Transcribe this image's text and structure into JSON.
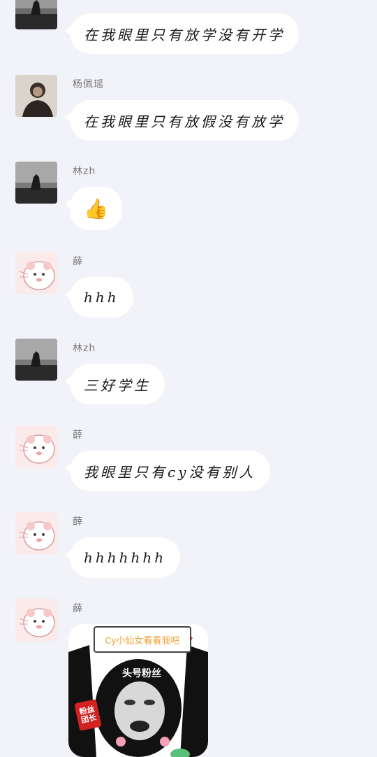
{
  "messages": [
    {
      "sender": "",
      "avatar": "dark-silhouette-avatar",
      "text": "在我眼里只有放学没有开学"
    },
    {
      "sender": "杨佩瑶",
      "avatar": "portrait-avatar",
      "text": "在我眼里只有放假没有放学"
    },
    {
      "sender": "林zh",
      "avatar": "dark-silhouette-avatar",
      "text": "👍"
    },
    {
      "sender": "薛",
      "avatar": "hamster-avatar",
      "text": "hhh"
    },
    {
      "sender": "林zh",
      "avatar": "dark-silhouette-avatar",
      "text": "三好学生"
    },
    {
      "sender": "薛",
      "avatar": "hamster-avatar",
      "text": "我眼里只有cy没有别人"
    },
    {
      "sender": "薛",
      "avatar": "hamster-avatar",
      "text": "hhhhhhh"
    },
    {
      "sender": "薛",
      "avatar": "hamster-avatar",
      "sticker": {
        "banner": "Cy小仙女看看我吧",
        "caption": "头号粉丝",
        "badge": "粉丝团长"
      }
    }
  ],
  "colors": {
    "background": "#f2f3f9",
    "bubble": "#ffffff",
    "text": "#1a1a1a"
  }
}
